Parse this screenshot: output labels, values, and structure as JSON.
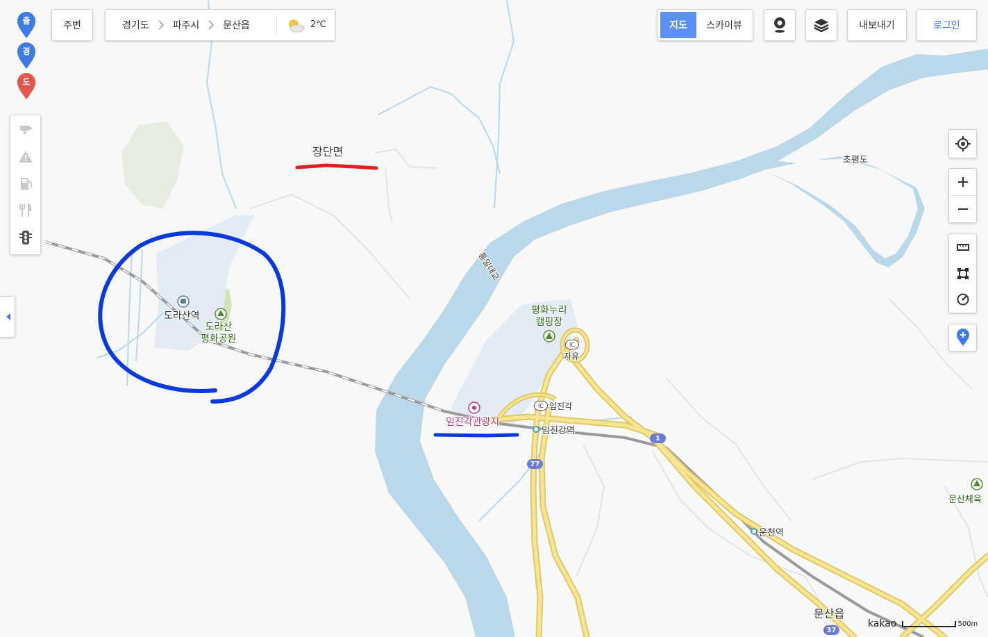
{
  "route_pins": [
    {
      "label": "출",
      "color": "#3e7be6"
    },
    {
      "label": "경",
      "color": "#3e7be6"
    },
    {
      "label": "도",
      "color": "#e5574c"
    }
  ],
  "top_bar": {
    "nearby_button": "주변",
    "breadcrumb": [
      "경기도",
      "파주시",
      "문산읍"
    ],
    "weather": {
      "icon": "partly-cloudy-icon",
      "temperature": "2℃"
    }
  },
  "map_type": {
    "options": [
      "지도",
      "스카이뷰"
    ],
    "selected": "지도",
    "accent": "#5b8ff5"
  },
  "actions": {
    "export_label": "내보내기",
    "login_label": "로그인",
    "login_color": "#3d7fe0"
  },
  "left_tools": [
    "cctv-icon",
    "accident-icon",
    "gas-station-icon",
    "restaurant-icon",
    "traffic-light-icon"
  ],
  "right_tools": [
    "current-location-icon",
    "zoom-in-icon",
    "zoom-out-icon",
    "ruler-icon",
    "area-icon",
    "radius-icon",
    "add-place-icon"
  ],
  "map_labels": {
    "jangdan": "장단면",
    "chopyeong": "초평도",
    "bridge": "통일대교",
    "dorasan_station": "도라산역",
    "dorasan_park_1": "도라산",
    "dorasan_park_2": "평화공원",
    "campsite_1": "평화누리",
    "campsite_2": "캠핑장",
    "ic_jayu_badge": "IC",
    "ic_jayu": "자유",
    "ic_imjingak_badge": "IC",
    "ic_imjingak": "임진각",
    "imjingak_tourist": "임진각관광지",
    "imjingang_station": "임진강역",
    "uncheon_station": "운천역",
    "munsan": "문산읍",
    "munsan_gym": "문산체육",
    "route_1": "1",
    "route_77": "77",
    "route_37": "37"
  },
  "scale": {
    "logo": "kakao",
    "distance": "500m"
  },
  "annotations": [
    {
      "type": "underline",
      "color": "#e02020",
      "target": "장단면"
    },
    {
      "type": "circle",
      "color": "#0a3adf",
      "target": "도라산역"
    },
    {
      "type": "underline",
      "color": "#0a3adf",
      "target": "임진각관광지"
    }
  ]
}
